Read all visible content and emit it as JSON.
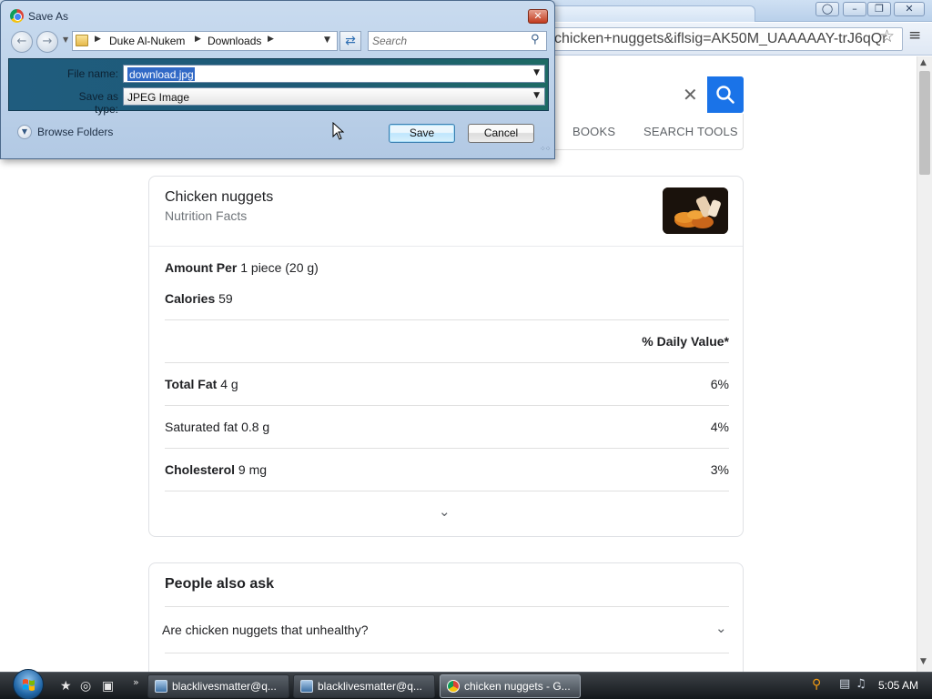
{
  "browser": {
    "address_text": "chicken+nuggets&iflsig=AK50M_UAAAAAY-trJ6qQr",
    "star_icon": "star-outline-icon",
    "menu_icon": "hamburger-menu-icon",
    "window_controls": [
      "user-icon",
      "minimize-icon",
      "restore-icon",
      "close-icon"
    ]
  },
  "search": {
    "clear_icon": "close-x-icon",
    "search_icon": "magnifier-icon",
    "accent_color": "#1a73e8",
    "tabs": [
      "BOOKS",
      "SEARCH TOOLS"
    ]
  },
  "nutrition": {
    "title": "Chicken nuggets",
    "subtitle": "Nutrition Facts",
    "amount_per_label": "Amount Per",
    "amount_per_value": "1 piece (20 g)",
    "calories_label": "Calories",
    "calories_value": "59",
    "daily_value_header": "% Daily Value*",
    "rows": [
      {
        "label": "Total Fat",
        "amount": "4 g",
        "dv": "6%",
        "bold": true
      },
      {
        "label": "Saturated fat",
        "amount": "0.8 g",
        "dv": "4%",
        "bold": false
      },
      {
        "label": "Cholesterol",
        "amount": "9 mg",
        "dv": "3%",
        "bold": true
      }
    ],
    "expand_icon": "chevron-down-icon"
  },
  "people_also_ask": {
    "title": "People also ask",
    "questions": [
      "Are chicken nuggets that unhealthy?"
    ]
  },
  "dialog": {
    "title": "Save As",
    "breadcrumb": [
      "Duke Al-Nukem",
      "Downloads"
    ],
    "search_placeholder": "Search",
    "filename_label": "File name:",
    "filename_value": "download.jpg",
    "savetype_label": "Save as type:",
    "savetype_value": "JPEG Image",
    "browse_folders_label": "Browse Folders",
    "save_label": "Save",
    "cancel_label": "Cancel"
  },
  "taskbar": {
    "items": [
      {
        "label": "blacklivesmatter@q...",
        "active": false
      },
      {
        "label": "blacklivesmatter@q...",
        "active": false
      },
      {
        "label": "chicken nuggets - G...",
        "active": true
      }
    ],
    "clock": "5:05 AM"
  }
}
